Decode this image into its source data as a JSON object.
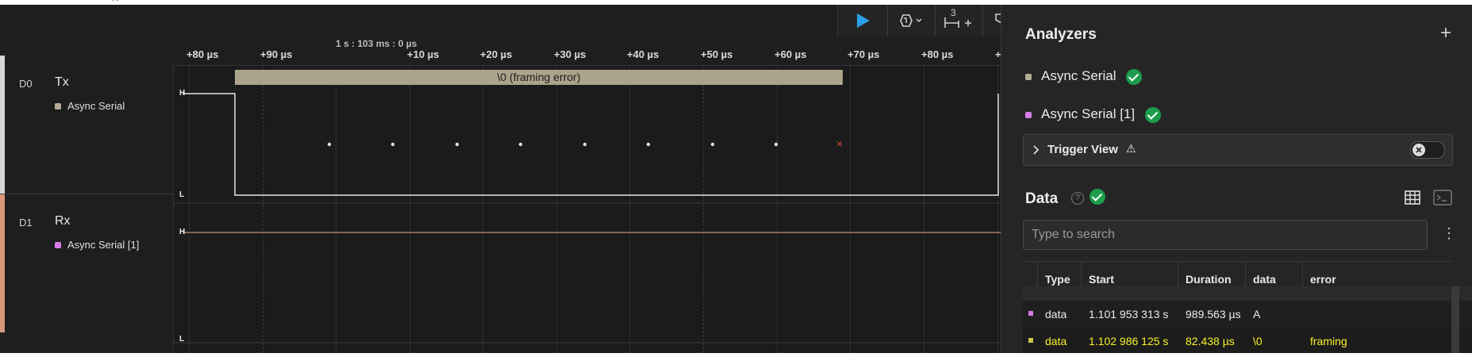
{
  "top_strip_text": "(                    )",
  "toolbar": {
    "badge_number": "3",
    "plus": "+"
  },
  "timeline": {
    "absolute_time": "1 s : 103 ms : 0 µs",
    "ticks": [
      "+80 µs",
      "+90 µs",
      "+10 µs",
      "+20 µs",
      "+30 µs",
      "+40 µs",
      "+50 µs",
      "+60 µs",
      "+70 µs",
      "+80 µs",
      "+"
    ]
  },
  "channels": [
    {
      "id": "D0",
      "name": "Tx",
      "analyzer": "Async Serial",
      "color": "#d6d6d6",
      "analyzer_color": "#b5ad93"
    },
    {
      "id": "D1",
      "name": "Rx",
      "analyzer": "Async Serial [1]",
      "color": "#d8967a",
      "analyzer_color": "#d67ce6"
    }
  ],
  "waveform": {
    "frame_label": "\\0 (framing error)",
    "high_label": "H",
    "low_label": "L",
    "error_marker": "×"
  },
  "analyzers_panel": {
    "title": "Analyzers",
    "add": "+",
    "items": [
      {
        "name": "Async Serial",
        "color": "#b5ad93"
      },
      {
        "name": "Async Serial [1]",
        "color": "#d67ce6"
      }
    ],
    "trigger_view": {
      "label": "Trigger View",
      "warning_icon": "⚠"
    },
    "data_title": "Data",
    "help_icon": "?",
    "search_placeholder": "Type to search",
    "more_icon": "⋮",
    "table": {
      "headers": [
        "Type",
        "Start",
        "Duration",
        "data",
        "error"
      ],
      "rows": [
        {
          "color": "#d67ce6",
          "type": "data",
          "start": "1.101 953 313 s",
          "duration": "989.563 µs",
          "data": "A",
          "error": ""
        },
        {
          "color": "#b5ad93",
          "type": "data",
          "start": "1.102 986 125 s",
          "duration": "82.438 µs",
          "data": "\\0",
          "error": "framing"
        }
      ]
    }
  }
}
